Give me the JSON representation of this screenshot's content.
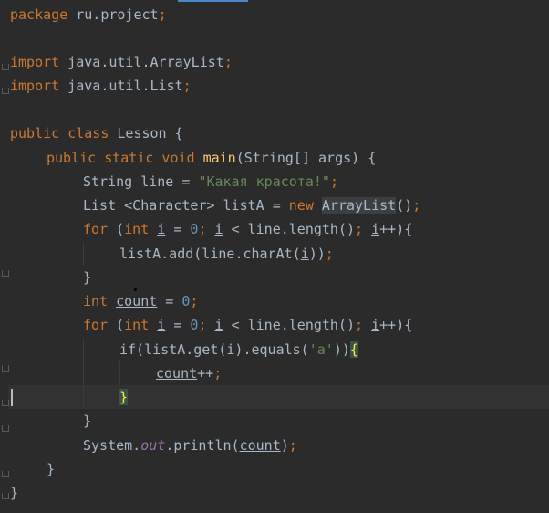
{
  "code": {
    "l1_kw": "package",
    "l1_rest": " ru.project",
    "l1_semi": ";",
    "l3_kw": "import",
    "l3_rest": " java.util.ArrayList",
    "l3_semi": ";",
    "l4_kw": "import",
    "l4_rest": " java.util.List",
    "l4_semi": ";",
    "l6_kw": "public class",
    "l6_rest": " Lesson {",
    "l7_kw": "public static void",
    "l7_fn": "main",
    "l7_rest": "(String[] args) {",
    "l8_a": "String line = ",
    "l8_str": "\"Какая красота!\"",
    "l8_semi": ";",
    "l9_a": "List <Character> listA = ",
    "l9_kw": "new",
    "l9_sel": "ArrayList",
    "l9_b": "()",
    "l9_semi": ";",
    "l10_for": "for",
    "l10_a": " (",
    "l10_int": "int",
    "l10_i1": "i",
    "l10_b": " = ",
    "l10_zero": "0",
    "l10_semi1": ";",
    "l10_i2": "i",
    "l10_c": " < line.length()",
    "l10_semi2": ";",
    "l10_i3": "i",
    "l10_d": "++){",
    "l11_a": "listA.add(line.charAt(",
    "l11_i": "i",
    "l11_b": "))",
    "l11_semi": ";",
    "l12": "}",
    "l13_int": "int",
    "l13_count": "count",
    "l13_b": " = ",
    "l13_zero": "0",
    "l13_semi": ";",
    "l14_for": "for",
    "l14_a": " (",
    "l14_int": "int",
    "l14_i1": "i",
    "l14_b": " = ",
    "l14_zero": "0",
    "l14_semi1": ";",
    "l14_i2": "i",
    "l14_c": " < line.length()",
    "l14_semi2": ";",
    "l14_i3": "i",
    "l14_d": "++){",
    "l15_a": "if(listA.get(i).equals(",
    "l15_str": "'a'",
    "l15_b": "))",
    "l15_brace": "{",
    "l16_count": "count",
    "l16_b": "++",
    "l16_semi": ";",
    "l17_brace": "}",
    "l18": "}",
    "l19_a": "System.",
    "l19_out": "out",
    "l19_b": ".println(",
    "l19_count": "count",
    "l19_c": ")",
    "l19_semi": ";",
    "l20": "}",
    "l21": "}"
  },
  "colors": {
    "background": "#2b2b2b",
    "keyword": "#cc7832",
    "string": "#6a8759",
    "number": "#6897bb",
    "method": "#ffc66d",
    "static_field": "#9876aa",
    "text": "#a9b7c6"
  }
}
